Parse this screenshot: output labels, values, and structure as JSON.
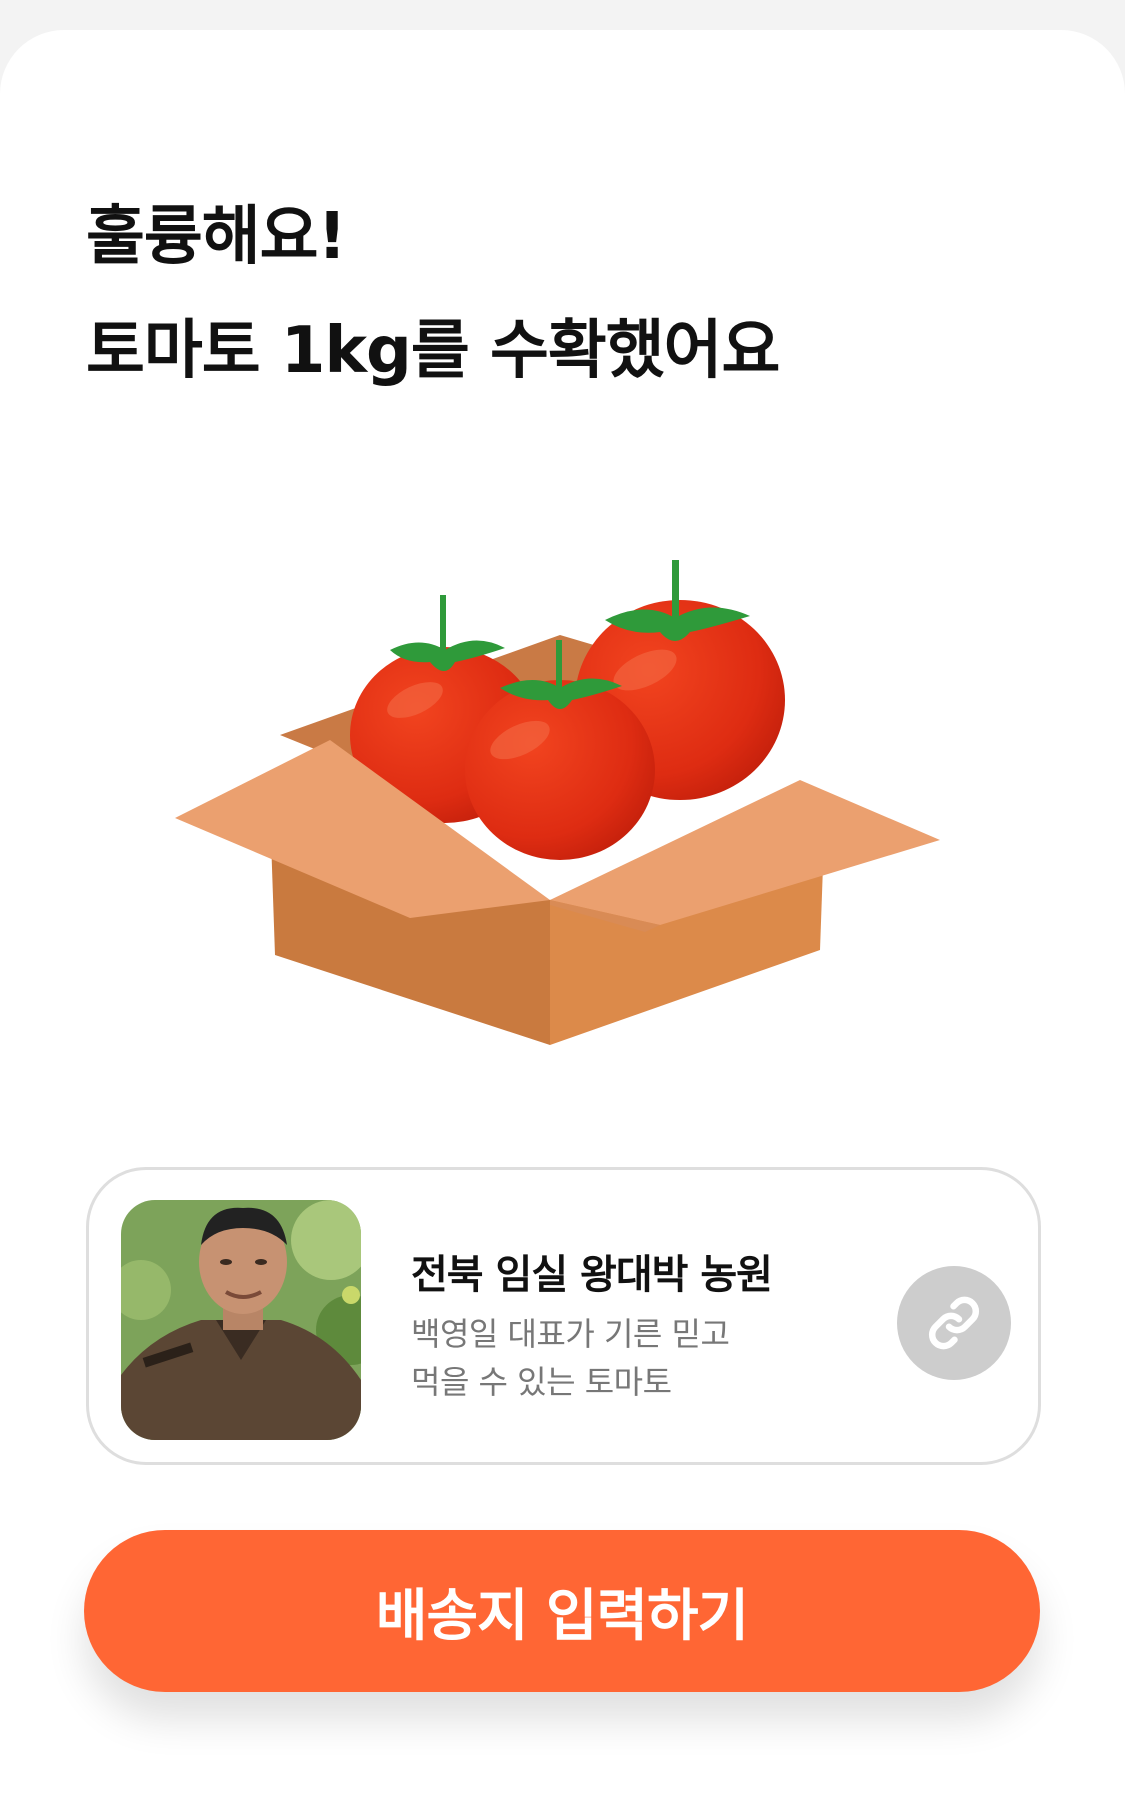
{
  "result": {
    "title_line1": "훌륭해요!",
    "title_line2": "토마토 1kg를 수확했어요"
  },
  "illustration": {
    "icon": "tomato-box-illustration"
  },
  "farm": {
    "name": "전북 임실 왕대박 농원",
    "desc_line1": "백영일 대표가 기른 믿고",
    "desc_line2": "먹을 수 있는 토마토",
    "link_icon": "link-icon"
  },
  "cta": {
    "label": "배송지 입력하기"
  },
  "colors": {
    "accent": "#ff6634",
    "tomato": "#e0301e",
    "box": "#e89a66",
    "link_button": "#cdcdcd"
  }
}
